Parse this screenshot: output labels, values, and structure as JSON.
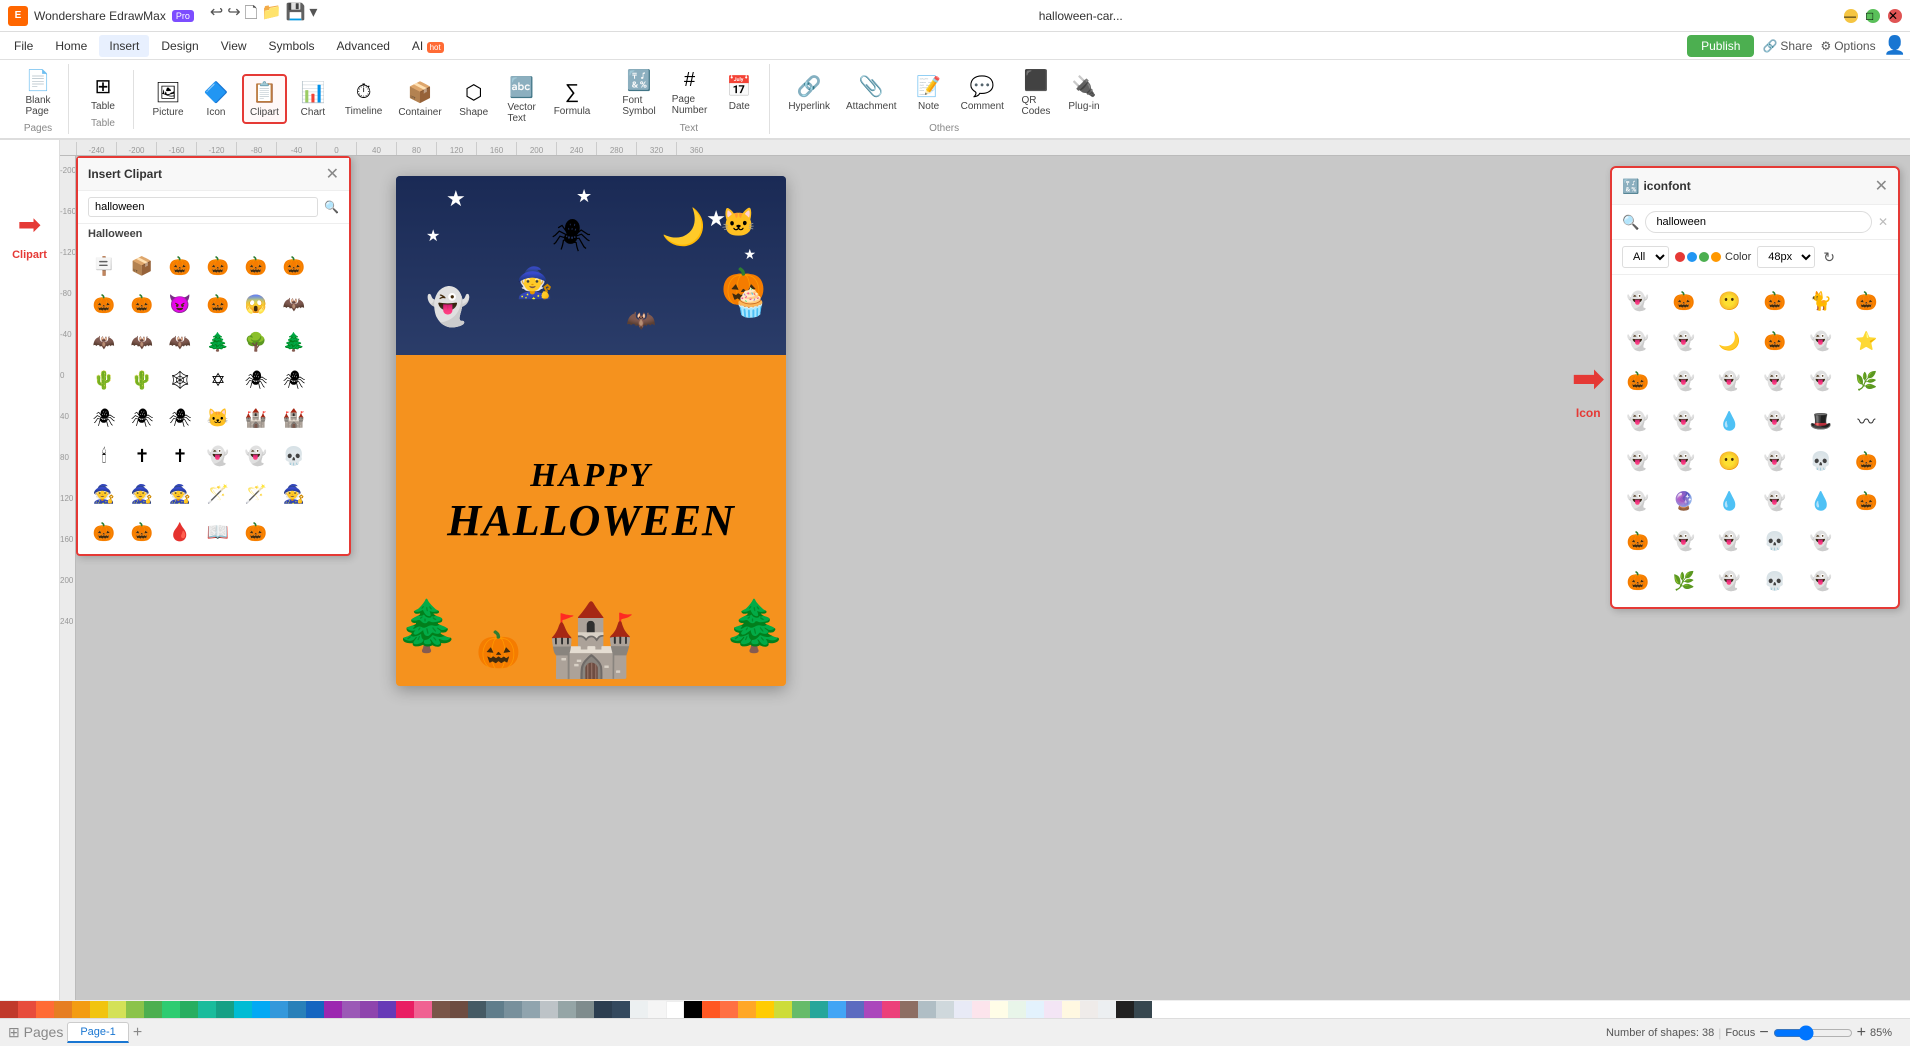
{
  "app": {
    "name": "Wondershare EdrawMax",
    "badge": "Pro",
    "file_title": "halloween-car..."
  },
  "window_controls": {
    "minimize": "—",
    "maximize": "□",
    "close": "✕"
  },
  "menu": {
    "items": [
      "File",
      "Home",
      "Insert",
      "Design",
      "View",
      "Symbols",
      "Advanced",
      "AI"
    ],
    "ai_badge": "hot",
    "active": "Insert"
  },
  "toolbar": {
    "groups": [
      {
        "label": "Pages",
        "items": [
          {
            "icon": "📄",
            "label": "Blank\nPage",
            "name": "blank-page-btn"
          }
        ]
      },
      {
        "label": "Table",
        "items": [
          {
            "icon": "⊞",
            "label": "Table",
            "name": "table-btn"
          }
        ]
      },
      {
        "label": "",
        "items": [
          {
            "icon": "🖼",
            "label": "Picture",
            "name": "picture-btn"
          },
          {
            "icon": "🔷",
            "label": "Icon",
            "name": "icon-btn",
            "active": false
          },
          {
            "icon": "📋",
            "label": "Clipart",
            "name": "clipart-btn",
            "active": true
          },
          {
            "icon": "📊",
            "label": "Chart",
            "name": "chart-btn"
          },
          {
            "icon": "⏱",
            "label": "Timeline",
            "name": "timeline-btn"
          },
          {
            "icon": "📦",
            "label": "Container",
            "name": "container-btn"
          },
          {
            "icon": "⬡",
            "label": "Shape",
            "name": "shape-btn"
          },
          {
            "icon": "🔤",
            "label": "Vector\nText",
            "name": "vector-text-btn"
          },
          {
            "icon": "∑",
            "label": "Formula",
            "name": "formula-btn"
          },
          {
            "icon": "🔣",
            "label": "Font\nSymbol",
            "name": "font-symbol-btn"
          },
          {
            "icon": "📄",
            "label": "Page\nNumber",
            "name": "page-number-btn"
          },
          {
            "icon": "📅",
            "label": "Date",
            "name": "date-btn"
          }
        ]
      },
      {
        "label": "Text",
        "items": []
      },
      {
        "label": "Others",
        "items": [
          {
            "icon": "🔗",
            "label": "Hyperlink",
            "name": "hyperlink-btn"
          },
          {
            "icon": "📎",
            "label": "Attachment",
            "name": "attachment-btn"
          },
          {
            "icon": "📝",
            "label": "Note",
            "name": "note-btn"
          },
          {
            "icon": "💬",
            "label": "Comment",
            "name": "comment-btn"
          },
          {
            "icon": "⬛",
            "label": "QR\nCodes",
            "name": "qr-codes-btn"
          },
          {
            "icon": "🔌",
            "label": "Plug-in",
            "name": "plugin-btn"
          }
        ]
      }
    ]
  },
  "header_actions": {
    "publish_label": "Publish",
    "share_label": "Share",
    "options_label": "Options"
  },
  "clipart_panel": {
    "title": "Insert Clipart",
    "search_placeholder": "halloween",
    "category": "Halloween",
    "close_icon": "✕",
    "items": [
      "🪧",
      "🎃",
      "🎃",
      "🎃",
      "🎃",
      "🎃",
      "",
      "🎃",
      "🎃",
      "🎃",
      "🎃",
      "🎃",
      "🦇",
      "",
      "🦇",
      "🦇",
      "🦇",
      "🌲",
      "🌳",
      "🌲",
      "",
      "🌵",
      "🌵",
      "🕸",
      "⭐",
      "🕷",
      "🕷",
      "",
      "🕷",
      "🕷",
      "🕷",
      "🐈",
      "🏰",
      "🏰",
      "",
      "🕯",
      "✝",
      "✝",
      "👻",
      "👻",
      "💀",
      "",
      "🧙",
      "🧙",
      "🧙",
      "🪄",
      "🪄",
      "🧙",
      "",
      "🎃",
      "🎃",
      "🩸",
      "📖",
      "🎃",
      "",
      "  "
    ]
  },
  "iconfont_panel": {
    "title": "iconfont",
    "search_value": "halloween",
    "filter_all": "All",
    "filter_color": "Color",
    "filter_size": "48px",
    "icon_count": 38,
    "icons": [
      "👻",
      "🎃",
      "😶",
      "🎃",
      "🐱",
      "🎃",
      "👻",
      "👻",
      "🌙",
      "🎃",
      "👻",
      "⭐",
      "🎃",
      "👻",
      "👻",
      "👻",
      "👻",
      "🌿",
      "👻",
      "👻",
      "💧",
      "👻",
      "🧢",
      "〰",
      "👻",
      "👻",
      "😶",
      "👻",
      "💀",
      "🎃",
      "👻",
      "🔮",
      "💧",
      "👻",
      "💧",
      "🎃",
      "🎃",
      "👻",
      "👻",
      "💀",
      "👻",
      "",
      "🎃",
      "👻",
      "👻",
      "💀",
      "👻",
      ""
    ]
  },
  "canvas": {
    "zoom": "85%"
  },
  "pages": {
    "label": "Pages",
    "tabs": [
      {
        "label": "Page-1",
        "active": true
      }
    ],
    "add_label": "+"
  },
  "status": {
    "shapes_count": "Number of shapes: 38",
    "focus_label": "Focus",
    "zoom_value": "85%",
    "zoom_minus": "−",
    "zoom_plus": "+"
  },
  "sidebar": {
    "clipart_arrow_label": "Clipart",
    "icon_arrow_label": "Icon"
  },
  "colors": {
    "red_arrow": "#e53935",
    "active_border": "#e53935",
    "publish_bg": "#4CAF50",
    "poster_orange": "#f5921e",
    "poster_dark": "#1a2a55"
  },
  "palette": [
    "#c0392b",
    "#e74c3c",
    "#e67e22",
    "#f39c12",
    "#f1c40f",
    "#2ecc71",
    "#27ae60",
    "#1abc9c",
    "#16a085",
    "#3498db",
    "#2980b9",
    "#9b59b6",
    "#8e44ad",
    "#2c3e50",
    "#34495e",
    "#95a5a6",
    "#7f8c8d",
    "#bdc3c7",
    "#ecf0f1",
    "#ffffff"
  ]
}
